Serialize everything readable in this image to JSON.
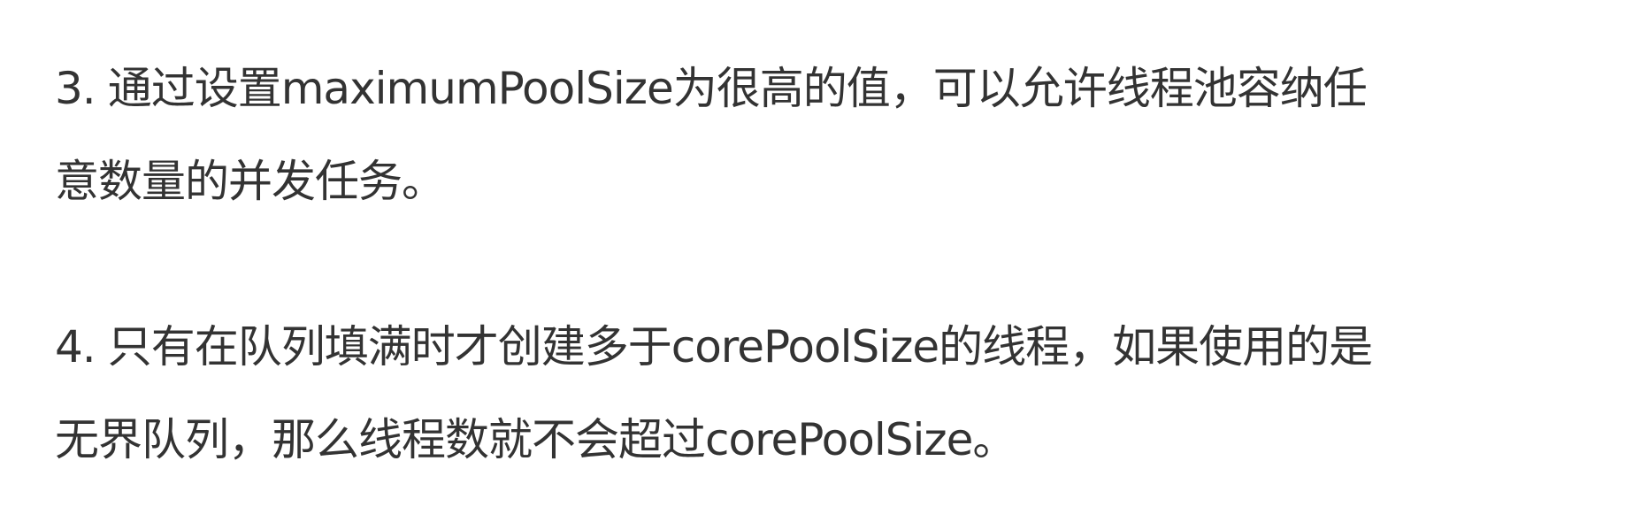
{
  "paragraphs": [
    {
      "number": "3.",
      "lines": [
        "通过设置maximumPoolSize为很高的值，可以允许线程池容纳任",
        "意数量的并发任务。"
      ]
    },
    {
      "number": "4.",
      "lines": [
        "只有在队列填满时才创建多于corePoolSize的线程，如果使用的是",
        "无界队列，那么线程数就不会超过corePoolSize。"
      ]
    }
  ]
}
